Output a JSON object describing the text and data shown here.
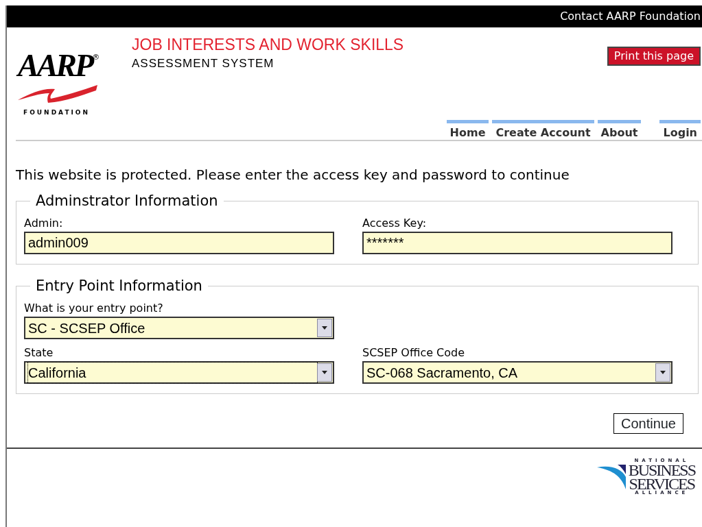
{
  "top_bar": {
    "link": "Contact AARP Foundation"
  },
  "header": {
    "logo": {
      "wordmark": "AARP",
      "mark": "®",
      "tagline": "FOUNDATION"
    },
    "title": "JOB INTERESTS AND WORK SKILLS",
    "subtitle": "ASSESSMENT SYSTEM",
    "print_button": "Print this page"
  },
  "nav": [
    {
      "label": "Home"
    },
    {
      "label": "Create Account"
    },
    {
      "label": "About"
    },
    {
      "label": "Login"
    }
  ],
  "intro": "This website is protected. Please enter the access key and password to continue",
  "sections": [
    {
      "legend": "Adminstrator Information",
      "rows": [
        [
          {
            "kind": "text",
            "label": "Admin:",
            "value": "admin009"
          },
          {
            "kind": "text",
            "label": "Access Key:",
            "value": "*******"
          }
        ]
      ]
    },
    {
      "legend": "Entry Point Information",
      "rows": [
        [
          {
            "kind": "select",
            "label": "What is your entry point?",
            "value": "SC - SCSEP Office",
            "focused": false
          }
        ],
        [
          {
            "kind": "select",
            "label": "State",
            "value": "California",
            "focused": true
          },
          {
            "kind": "select",
            "label": "SCSEP Office Code",
            "value": "SC-068 Sacramento, CA",
            "focused": false
          }
        ]
      ]
    }
  ],
  "continue_button": "Continue",
  "footer_logo": {
    "top": "NATIONAL",
    "lines": [
      "BUSINESS",
      "SERVICES"
    ],
    "bottom": "ALLIANCE"
  }
}
